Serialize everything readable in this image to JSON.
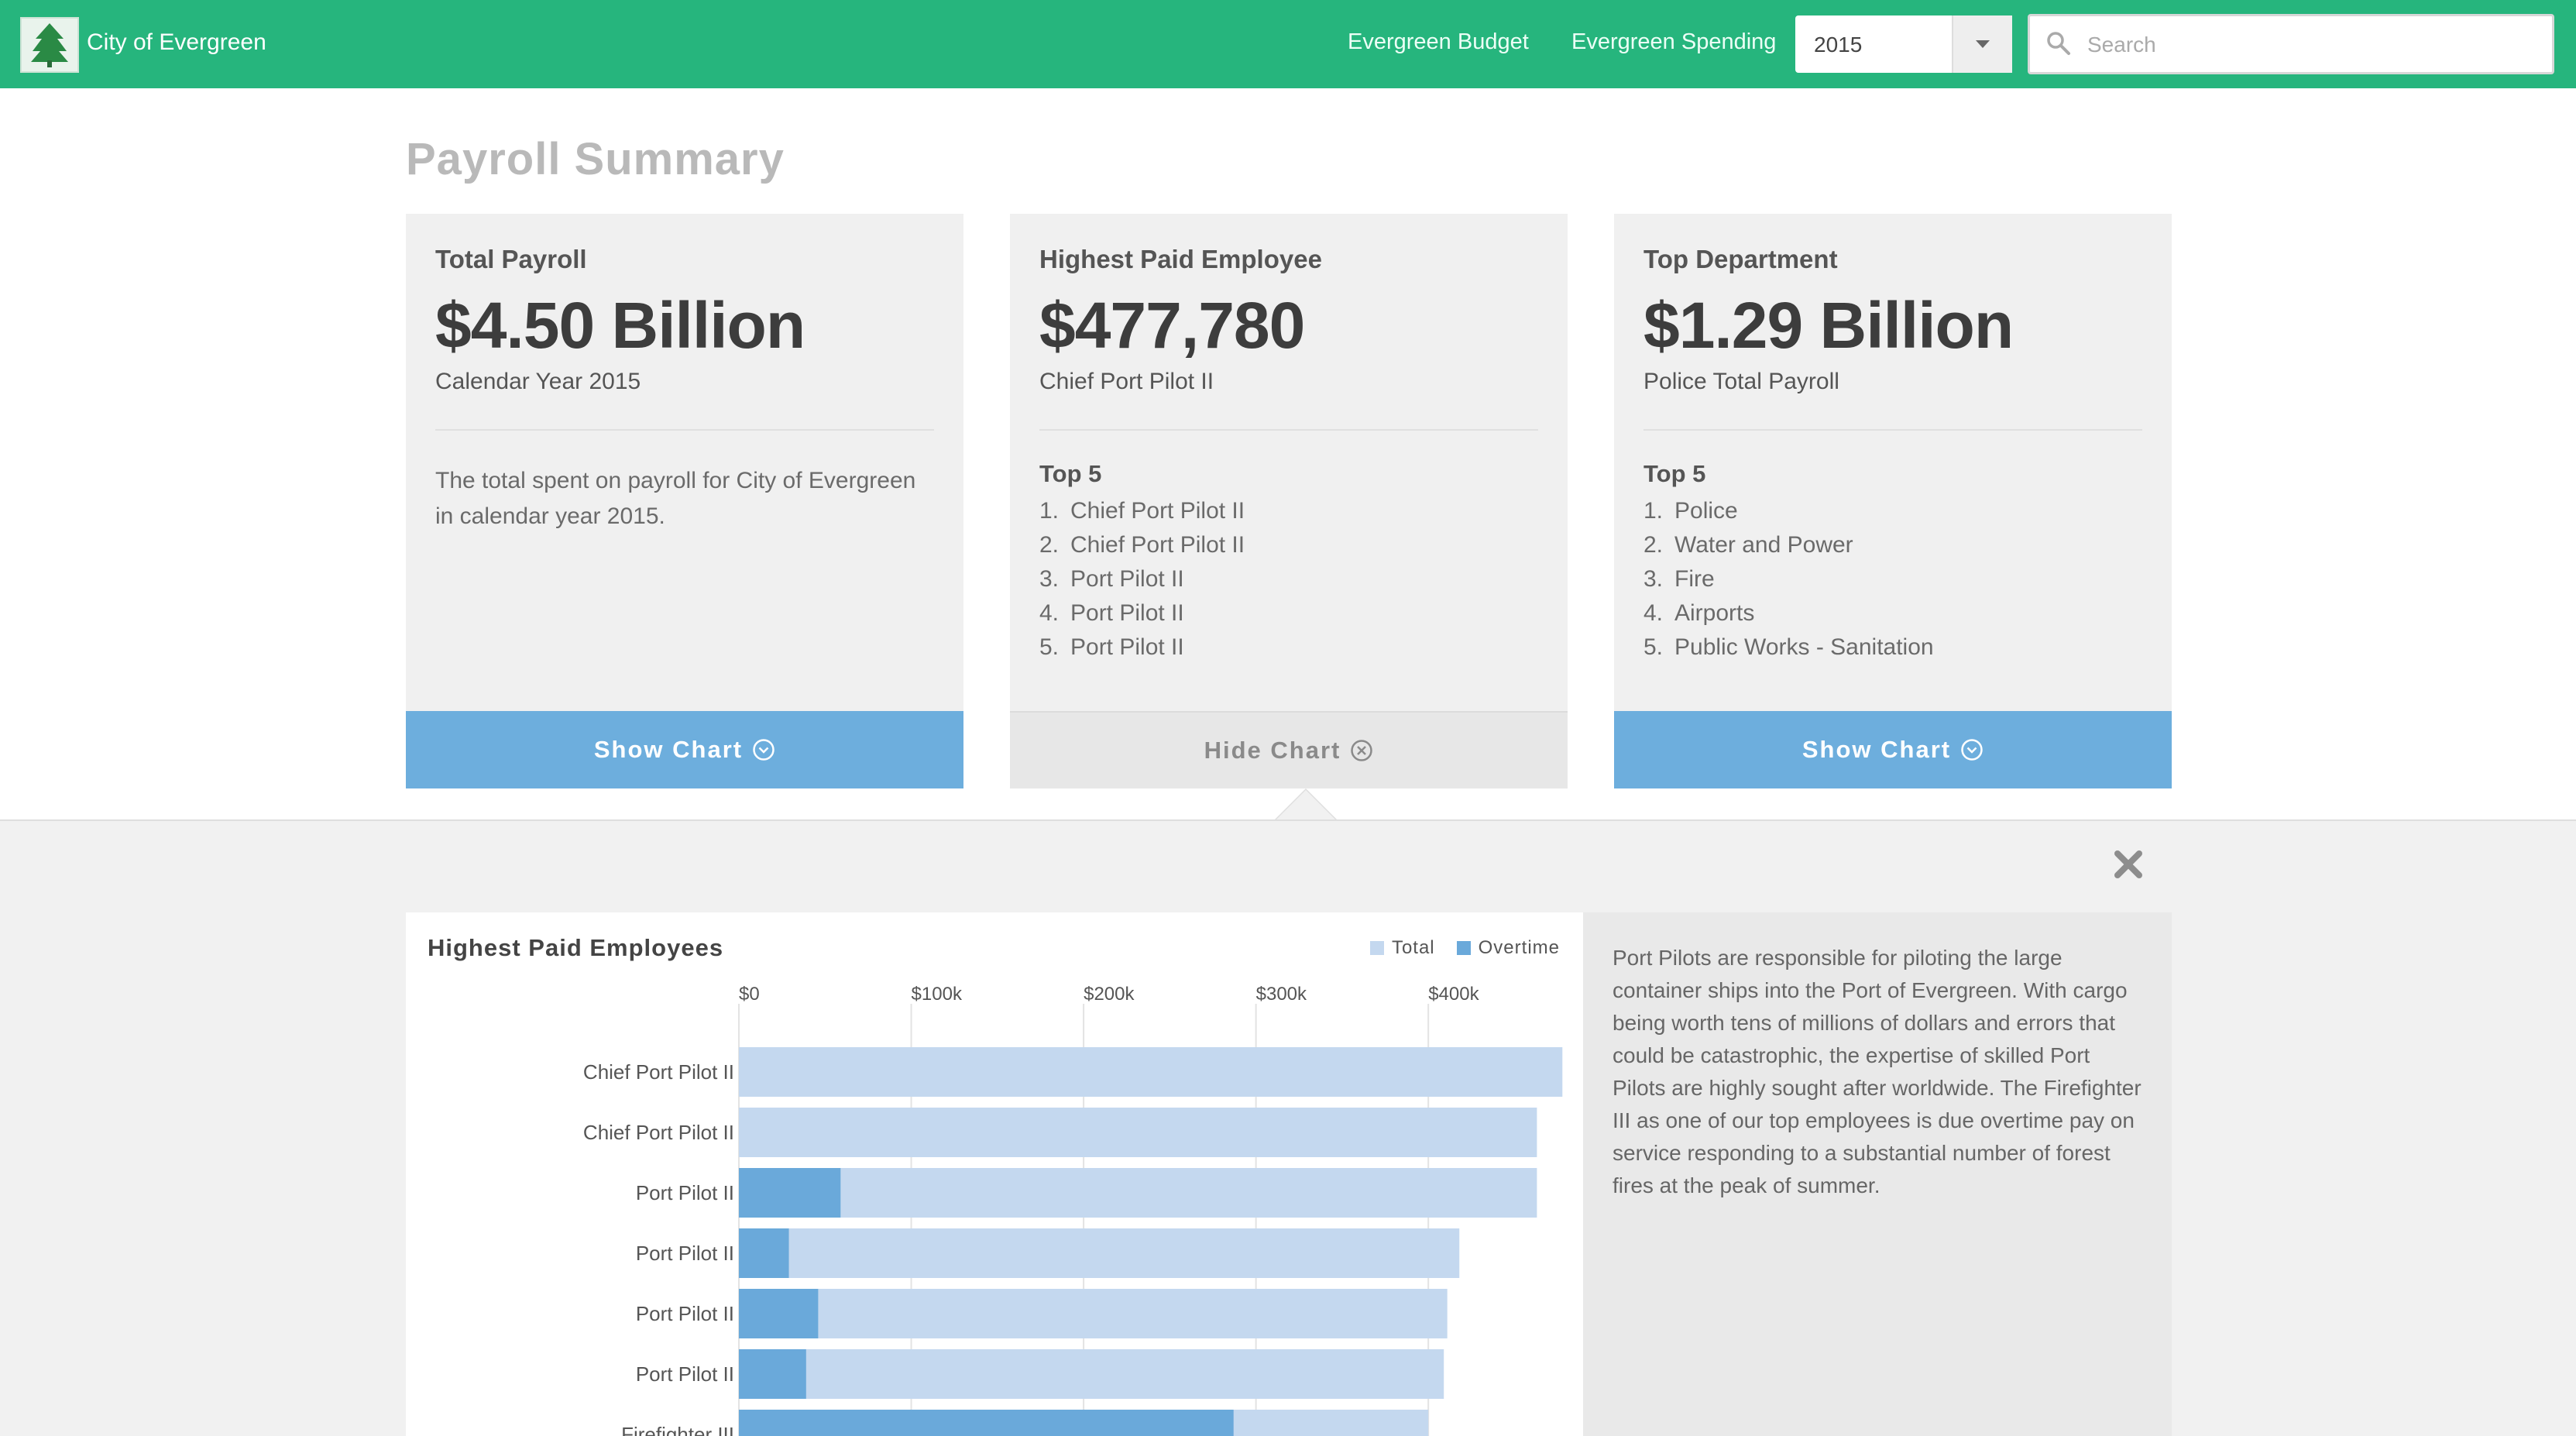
{
  "header": {
    "brand": "City of Evergreen",
    "nav": [
      "Evergreen Budget",
      "Evergreen Spending"
    ],
    "year_select": "2015",
    "search_placeholder": "Search",
    "colors": {
      "bar": "#26b57d"
    }
  },
  "page_title": "Payroll Summary",
  "cards": [
    {
      "label": "Total Payroll",
      "value": "$4.50 Billion",
      "sub": "Calendar Year 2015",
      "description": "The total spent on payroll for City of Evergreen in calendar year 2015.",
      "button": "Show Chart"
    },
    {
      "label": "Highest Paid Employee",
      "value": "$477,780",
      "sub": "Chief Port Pilot II",
      "top5_title": "Top 5",
      "top5": [
        "Chief Port Pilot II",
        "Chief Port Pilot II",
        "Port Pilot II",
        "Port Pilot II",
        "Port Pilot II"
      ],
      "button": "Hide Chart"
    },
    {
      "label": "Top Department",
      "value": "$1.29 Billion",
      "sub": "Police Total Payroll",
      "top5_title": "Top 5",
      "top5": [
        "Police",
        "Water and Power",
        "Fire",
        "Airports",
        "Public Works - Sanitation"
      ],
      "button": "Show Chart"
    }
  ],
  "panel": {
    "chart_title": "Highest Paid Employees",
    "legend": [
      {
        "label": "Total",
        "color": "#c4d8ef"
      },
      {
        "label": "Overtime",
        "color": "#6aa9da"
      }
    ],
    "info": "Port Pilots are responsible for piloting the large container ships into the Port of Evergreen. With cargo being worth tens of millions of dollars and errors that could be catastrophic, the expertise of skilled Port Pilots are highly sought after worldwide. The Firefighter III as one of our top employees is due overtime pay on service responding to a substantial number of forest fires at the peak of summer."
  },
  "chart_data": {
    "type": "bar",
    "orientation": "horizontal",
    "title": "Highest Paid Employees",
    "categories": [
      "Chief Port Pilot II",
      "Chief Port Pilot II",
      "Port Pilot II",
      "Port Pilot II",
      "Port Pilot II",
      "Port Pilot II",
      "Firefighter III"
    ],
    "series": [
      {
        "name": "Total",
        "values": [
          477780,
          463000,
          463000,
          418000,
          411000,
          409000,
          400000
        ]
      },
      {
        "name": "Overtime",
        "values": [
          0,
          0,
          59000,
          29000,
          46000,
          39000,
          287000
        ]
      }
    ],
    "x_ticks": [
      "$0",
      "$100k",
      "$200k",
      "$300k",
      "$400k"
    ],
    "xlim": [
      0,
      479000
    ],
    "grid": true,
    "legend_position": "top-right"
  }
}
